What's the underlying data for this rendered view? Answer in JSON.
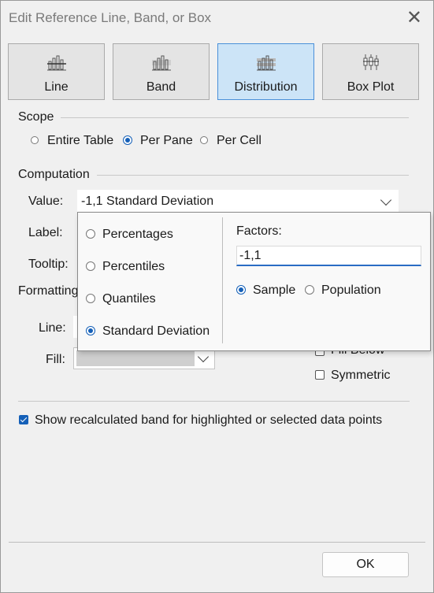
{
  "window": {
    "title": "Edit Reference Line, Band, or Box",
    "close_icon": "close-icon"
  },
  "tabs": [
    {
      "label": "Line",
      "icon": "line-chart-icon",
      "active": false
    },
    {
      "label": "Band",
      "icon": "band-chart-icon",
      "active": false
    },
    {
      "label": "Distribution",
      "icon": "distribution-chart-icon",
      "active": true
    },
    {
      "label": "Box Plot",
      "icon": "box-plot-icon",
      "active": false
    }
  ],
  "scope": {
    "heading": "Scope",
    "options": [
      {
        "label": "Entire Table",
        "selected": false
      },
      {
        "label": "Per Pane",
        "selected": true
      },
      {
        "label": "Per Cell",
        "selected": false
      }
    ]
  },
  "computation": {
    "heading": "Computation",
    "value_label": "Value:",
    "value_selected": "-1,1 Standard Deviation",
    "label_label": "Label:",
    "tooltip_label": "Tooltip:"
  },
  "distribution_popup": {
    "options": [
      {
        "label": "Percentages",
        "selected": false
      },
      {
        "label": "Percentiles",
        "selected": false
      },
      {
        "label": "Quantiles",
        "selected": false
      },
      {
        "label": "Standard Deviation",
        "selected": true
      }
    ],
    "factors_label": "Factors:",
    "factors_value": "-1,1",
    "sample_label": "Sample",
    "sample_selected": true,
    "population_label": "Population",
    "population_selected": false
  },
  "formatting": {
    "heading": "Formatting",
    "line_label": "Line:",
    "fill_label": "Fill:",
    "fill_below_label": "Fill Below",
    "symmetric_label": "Symmetric",
    "fill_color": "#cfcfcf"
  },
  "recalculated": {
    "label": "Show recalculated band for highlighted or selected data points",
    "checked": true
  },
  "ok_label": "OK",
  "colors": {
    "accent": "#1560b8",
    "active_tab": "#cce4f7",
    "dialog_bg": "#f0f0f0"
  }
}
